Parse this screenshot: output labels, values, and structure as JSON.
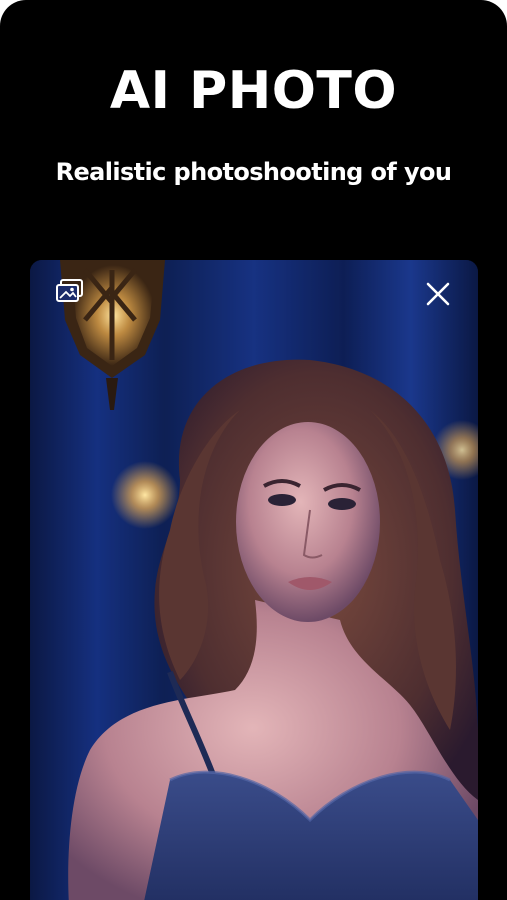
{
  "header": {
    "title": "AI PHOTO",
    "subtitle": "Realistic photoshooting of you"
  },
  "photo_card": {
    "image_subject": "woman-portrait",
    "gallery_icon": "gallery-icon",
    "close_icon": "close-icon"
  },
  "colors": {
    "background": "#000000",
    "text": "#ffffff",
    "photo_blue": "#1b3a96"
  }
}
